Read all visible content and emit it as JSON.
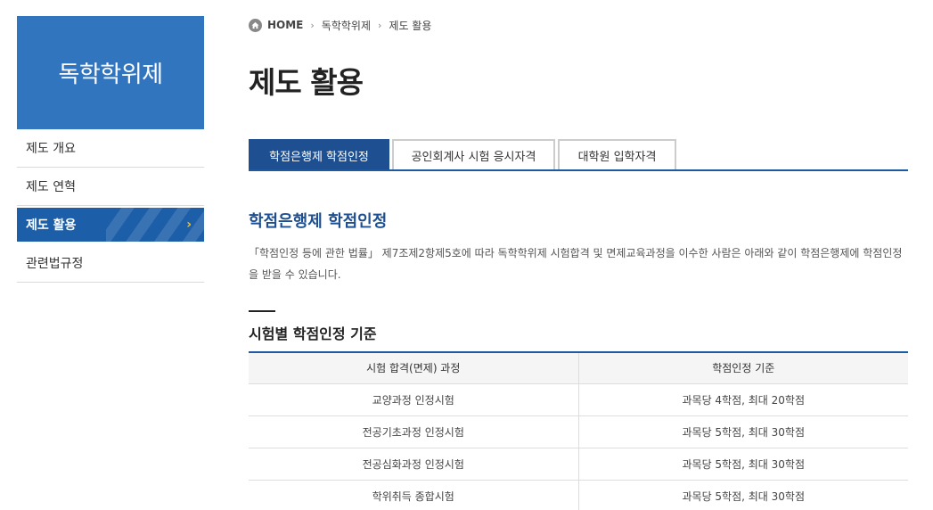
{
  "sidebar": {
    "title": "독학학위제",
    "items": [
      {
        "label": "제도 개요"
      },
      {
        "label": "제도 연혁"
      },
      {
        "label": "제도 활용"
      },
      {
        "label": "관련법규정"
      }
    ],
    "active_index": 2
  },
  "breadcrumb": {
    "home": "HOME",
    "level1": "독학학위제",
    "level2": "제도 활용"
  },
  "page_title": "제도 활용",
  "tabs": [
    {
      "label": "학점은행제 학점인정"
    },
    {
      "label": "공인회계사 시험 응시자격"
    },
    {
      "label": "대학원 입학자격"
    }
  ],
  "section": {
    "title": "학점은행제 학점인정",
    "description": "「학점인정 등에 관한 법률」 제7조제2항제5호에 따라 독학학위제 시험합격 및 면제교육과정을 이수한 사람은 아래와 같이 학점은행제에 학점인정을 받을 수 있습니다."
  },
  "criteria": {
    "title": "시험별 학점인정 기준",
    "headers": [
      "시험 합격(면제) 과정",
      "학점인정 기준"
    ],
    "rows": [
      [
        "교양과정 인정시험",
        "과목당 4학점, 최대 20학점"
      ],
      [
        "전공기초과정 인정시험",
        "과목당 5학점, 최대 30학점"
      ],
      [
        "전공심화과정 인정시험",
        "과목당 5학점, 최대 30학점"
      ],
      [
        "학위취득 종합시험",
        "과목당 5학점, 최대 30학점"
      ]
    ]
  },
  "colors": {
    "sidebar_title_bg": "#3175bf",
    "active_nav_bg": "#1d5ea8",
    "active_tab_bg": "#1d4f91",
    "accent_text": "#1d4f91",
    "chevron": "#f2c12e"
  },
  "icons": {
    "home": "home-icon",
    "breadcrumb_sep": "chevron-right-icon",
    "active_nav": "chevron-right-icon"
  }
}
